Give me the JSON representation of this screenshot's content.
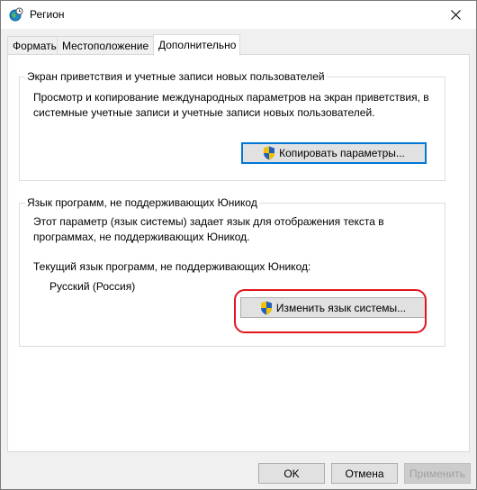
{
  "window": {
    "title": "Регион",
    "icon": "globe-clock-icon"
  },
  "tabs": [
    {
      "label": "Форматы",
      "active": false
    },
    {
      "label": "Местоположение",
      "active": false
    },
    {
      "label": "Дополнительно",
      "active": true
    }
  ],
  "welcome_group": {
    "legend": "Экран приветствия и учетные записи новых пользователей",
    "description_line1": "Просмотр и копирование международных параметров на экран приветствия, в",
    "description_line2": "системные учетные записи и учетные записи новых пользователей.",
    "copy_button_label": "Копировать параметры..."
  },
  "nonunicode_group": {
    "legend": "Язык программ, не поддерживающих Юникод",
    "description_line1": "Этот параметр (язык системы) задает язык для отображения текста в",
    "description_line2": "программах, не поддерживающих Юникод.",
    "current_label": "Текущий язык программ, не поддерживающих Юникод:",
    "current_value": "Русский (Россия)",
    "change_button_label": "Изменить язык системы..."
  },
  "footer": {
    "ok_label": "OK",
    "cancel_label": "Отмена",
    "apply_label": "Применить"
  },
  "colors": {
    "accent": "#0078d7",
    "highlight": "#e2141c",
    "shield_blue": "#1f5fbf",
    "shield_yellow": "#f2c200"
  }
}
